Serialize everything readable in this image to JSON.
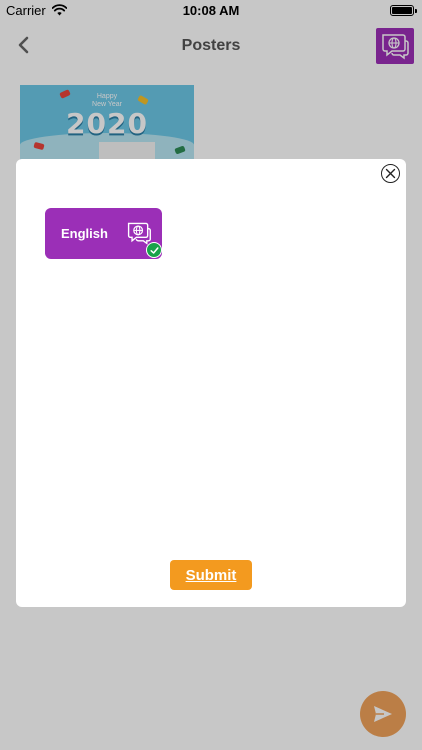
{
  "status_bar": {
    "carrier": "Carrier",
    "time": "10:08 AM"
  },
  "nav": {
    "title": "Posters",
    "back_icon": "chevron-left-icon",
    "language_icon": "language-chat-icon"
  },
  "posters": [
    {
      "subtitle_line1": "Happy",
      "subtitle_line2": "New Year",
      "year_text": "2020"
    }
  ],
  "language_modal": {
    "options": [
      {
        "label": "English",
        "icon": "language-chat-icon",
        "selected": true
      }
    ],
    "submit_label": "Submit",
    "close_icon": "close-circle-icon"
  },
  "colors": {
    "accent_purple": "#9b2fb7",
    "submit_orange": "#f39a1f",
    "check_green": "#18a34a",
    "fab_orange": "#f0a25a"
  }
}
